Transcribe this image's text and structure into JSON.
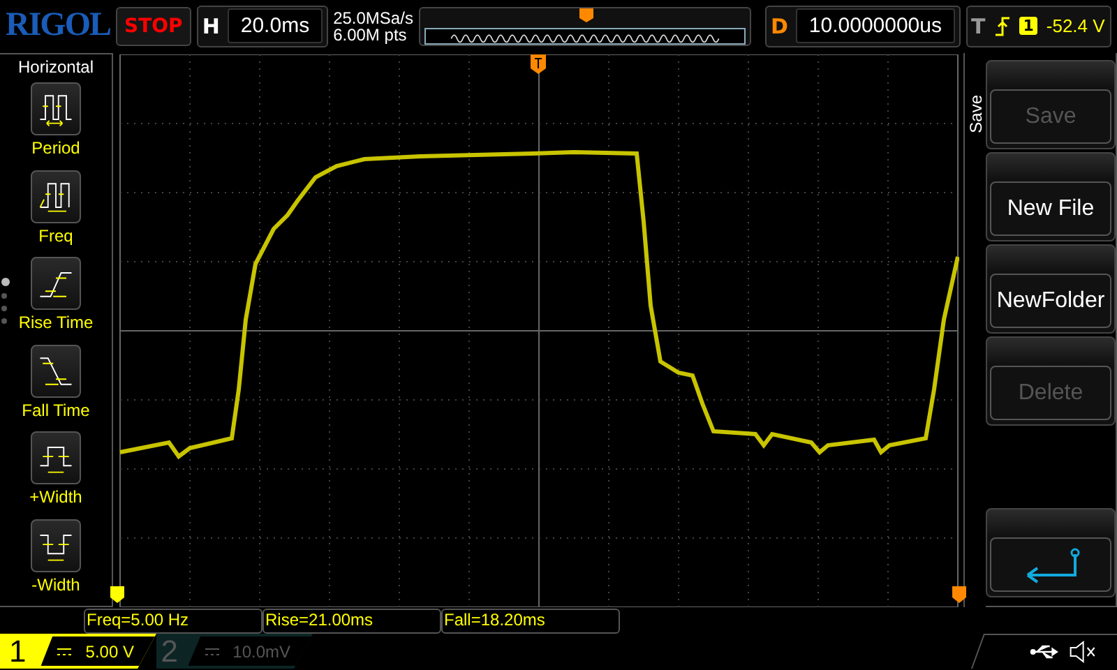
{
  "header": {
    "logo": "RIGOL",
    "run_state": "STOP",
    "timebase": {
      "label": "H",
      "value": "20.0ms"
    },
    "sample_rate": "25.0MSa/s",
    "memory_depth": "6.00M pts",
    "delay": {
      "label": "D",
      "value": "10.0000000us"
    },
    "trigger": {
      "label": "T",
      "source": "1",
      "level": "-52.4 V"
    }
  },
  "sidebar": {
    "title": "Horizontal",
    "pages": [
      {
        "selected": true
      },
      {
        "selected": false
      },
      {
        "selected": false
      },
      {
        "selected": false
      }
    ],
    "items": [
      {
        "kind": "period",
        "label": "Period"
      },
      {
        "kind": "freq",
        "label": "Freq"
      },
      {
        "kind": "rise",
        "label": "Rise Time"
      },
      {
        "kind": "fall",
        "label": "Fall Time"
      },
      {
        "kind": "pwidth",
        "label": "+Width"
      },
      {
        "kind": "nwidth",
        "label": "-Width"
      }
    ]
  },
  "menu": {
    "title": "Save",
    "buttons": [
      {
        "kind": "text",
        "label": "Save",
        "disabled": true
      },
      {
        "kind": "text",
        "label": "New File",
        "disabled": false
      },
      {
        "kind": "text",
        "label": "NewFolder",
        "disabled": false
      },
      {
        "kind": "text",
        "label": "Delete",
        "disabled": true
      },
      {
        "kind": "back",
        "disabled": false
      }
    ]
  },
  "measurements": [
    "Freq=5.00 Hz",
    "Rise=21.00ms",
    "Fall=18.20ms"
  ],
  "channels": [
    {
      "number": "1",
      "scale": "5.00 V",
      "selected": true
    },
    {
      "number": "2",
      "scale": "10.0mV",
      "selected": false
    }
  ]
}
